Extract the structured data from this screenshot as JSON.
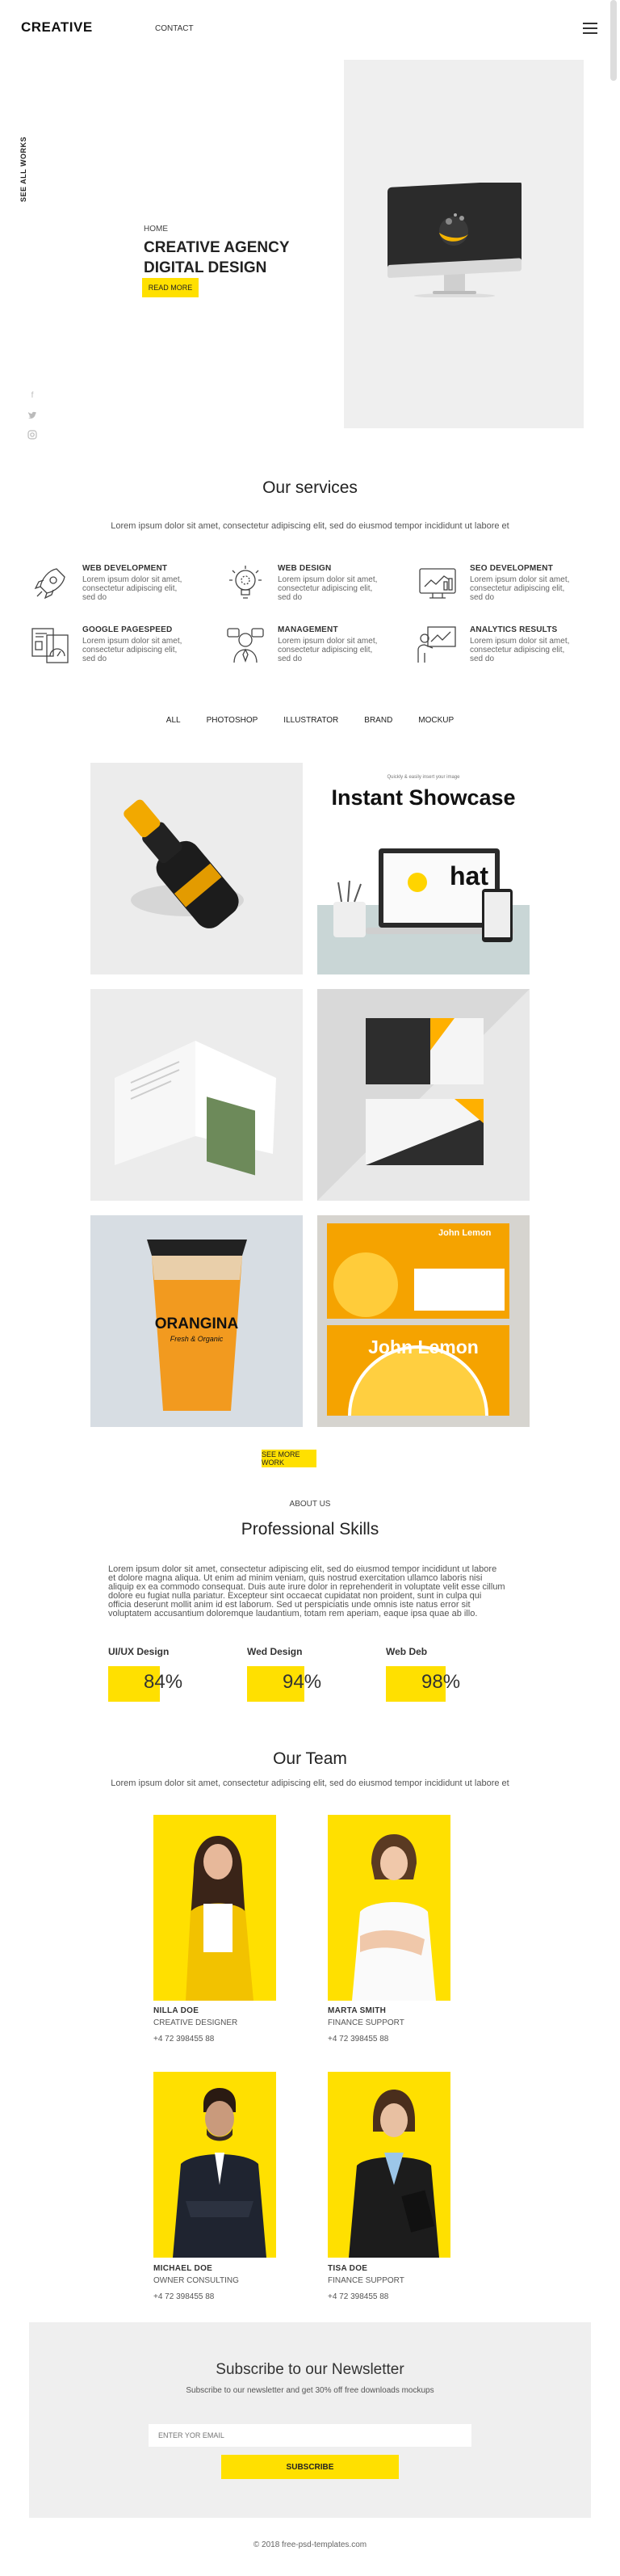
{
  "header": {
    "brand": "CREATIVE",
    "nav_contact": "CONTACT",
    "menu_icon": "hamburger-icon"
  },
  "hero": {
    "side_link": "SEE ALL WORKS",
    "social_icons": [
      "facebook-icon",
      "twitter-icon",
      "instagram-icon"
    ],
    "kicker": "HOME",
    "title_line1": "CREATIVE AGENCY",
    "title_line2": "DIGITAL DESIGN",
    "button": "READ MORE"
  },
  "services": {
    "title": "Our services",
    "lead": "Lorem ipsum dolor sit amet, consectetur adipiscing elit, sed do eiusmod tempor incididunt ut labore et",
    "items": [
      {
        "title": "WEB DEVELOPMENT",
        "desc": "Lorem ipsum dolor sit amet, consectetur adipiscing elit, sed do",
        "icon": "rocket-icon"
      },
      {
        "title": "WEB DESIGN",
        "desc": "Lorem ipsum dolor sit amet, consectetur adipiscing elit, sed do",
        "icon": "lightbulb-icon"
      },
      {
        "title": "SEO DEVELOPMENT",
        "desc": "Lorem ipsum dolor sit amet, consectetur adipiscing elit, sed do",
        "icon": "analytics-screen-icon"
      },
      {
        "title": "GOOGLE PAGESPEED",
        "desc": "Lorem ipsum dolor sit amet, consectetur adipiscing elit, sed do",
        "icon": "speed-document-icon"
      },
      {
        "title": "MANAGEMENT",
        "desc": "Lorem ipsum dolor sit amet, consectetur adipiscing elit, sed do",
        "icon": "manager-icon"
      },
      {
        "title": "ANALYTICS RESULTS",
        "desc": "Lorem ipsum dolor sit amet, consectetur adipiscing elit, sed do",
        "icon": "presentation-icon"
      }
    ]
  },
  "portfolio": {
    "filters": [
      "ALL",
      "PHOTOSHOP",
      "ILLUSTRATOR",
      "BRAND",
      "MOCKUP"
    ],
    "showcase_small": "Quickly & easily insert your image",
    "showcase_title": "Instant Showcase",
    "showcase_word": "hat",
    "bottle_label": "ORANGINA",
    "bottle_sub": "Fresh & Organic",
    "card_name": "John Lemon",
    "see_more": "SEE MORE WORK"
  },
  "about": {
    "kicker": "ABOUT US",
    "title": "Professional Skills",
    "text": "Lorem ipsum dolor sit amet, consectetur adipiscing elit, sed do eiusmod tempor incididunt ut labore et dolore magna aliqua. Ut enim ad minim veniam, quis nostrud exercitation ullamco laboris nisi aliquip ex ea commodo consequat. Duis aute irure dolor in reprehenderit in voluptate velit esse cillum dolore eu fugiat nulla pariatur. Excepteur sint occaecat cupidatat non proident, sunt in culpa qui officia deserunt mollit anim id est laborum. Sed ut perspiciatis unde omnis iste natus error sit voluptatem accusantium doloremque laudantium, totam rem aperiam, eaque ipsa quae ab illo.",
    "skills": [
      {
        "name": "UI/UX Design",
        "value": "84%",
        "percent": 84
      },
      {
        "name": "Wed Design",
        "value": "94%",
        "percent": 94
      },
      {
        "name": "Web Deb",
        "value": "98%",
        "percent": 98
      }
    ]
  },
  "team": {
    "title": "Our Team",
    "lead": "Lorem ipsum dolor sit amet, consectetur adipiscing elit, sed do eiusmod tempor incididunt ut labore et",
    "members": [
      {
        "name": "NILLA DOE",
        "role": "CREATIVE DESIGNER",
        "phone": "+4 72 398455 88"
      },
      {
        "name": "MARTA SMITH",
        "role": "FINANCE SUPPORT",
        "phone": "+4 72 398455 88"
      },
      {
        "name": "MICHAEL DOE",
        "role": "OWNER CONSULTING",
        "phone": "+4 72 398455 88"
      },
      {
        "name": "TISA DOE",
        "role": "FINANCE SUPPORT",
        "phone": "+4 72 398455 88"
      }
    ]
  },
  "newsletter": {
    "title": "Subscribe to our Newsletter",
    "subtitle": "Subscribe to our newsletter and get 30% off free downloads mockups",
    "placeholder": "ENTER YOR EMAIL",
    "button": "SUBSCRIBE"
  },
  "footer": {
    "copyright": "© 2018 free-psd-templates.com"
  },
  "colors": {
    "accent": "#ffe000",
    "panel": "#efefef",
    "text": "#333333"
  }
}
